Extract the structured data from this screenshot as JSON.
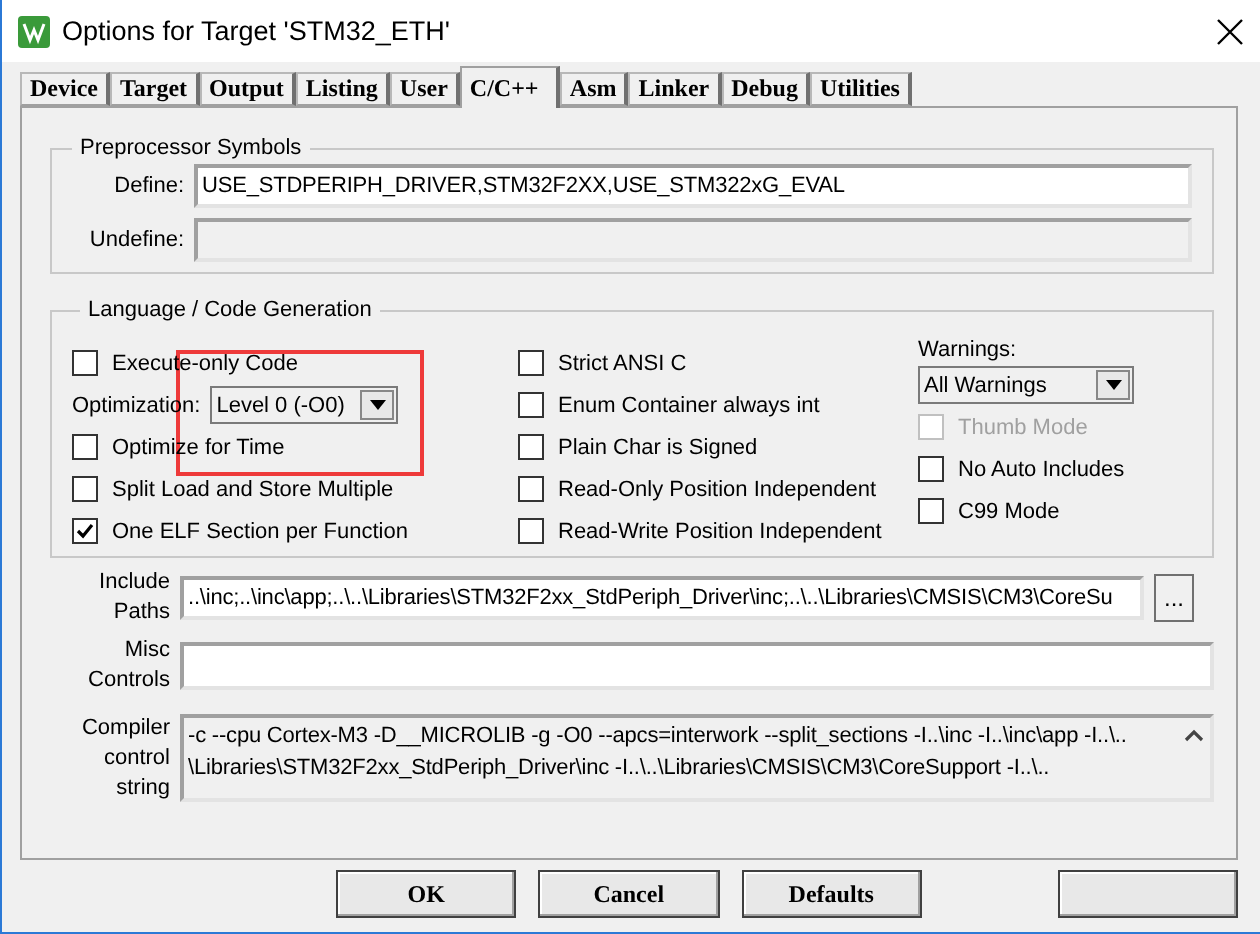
{
  "window": {
    "title": "Options for Target 'STM32_ETH'"
  },
  "tabs": [
    {
      "label": "Device",
      "selected": false
    },
    {
      "label": "Target",
      "selected": false
    },
    {
      "label": "Output",
      "selected": false
    },
    {
      "label": "Listing",
      "selected": false
    },
    {
      "label": "User",
      "selected": false
    },
    {
      "label": "C/C++",
      "selected": true
    },
    {
      "label": "Asm",
      "selected": false
    },
    {
      "label": "Linker",
      "selected": false
    },
    {
      "label": "Debug",
      "selected": false
    },
    {
      "label": "Utilities",
      "selected": false
    }
  ],
  "preprocessor": {
    "title": "Preprocessor Symbols",
    "define": {
      "label": "Define:",
      "value": "USE_STDPERIPH_DRIVER,STM32F2XX,USE_STM322xG_EVAL"
    },
    "undefine": {
      "label": "Undefine:",
      "disabled": true
    }
  },
  "language": {
    "title": "Language / Code Generation",
    "columns": [
      [
        {
          "kind": "checkbox",
          "label": "Execute-only Code",
          "checked": false,
          "disabled": false
        },
        {
          "kind": "select",
          "label": "Optimization:",
          "value": "Level 0 (-O0)"
        },
        {
          "kind": "checkbox",
          "label": "Optimize for Time",
          "checked": false,
          "disabled": false
        },
        {
          "kind": "checkbox",
          "label": "Split Load and Store Multiple",
          "checked": false,
          "disabled": false
        },
        {
          "kind": "checkbox",
          "label": "One ELF Section per Function",
          "checked": true,
          "disabled": false
        }
      ],
      [
        {
          "kind": "checkbox",
          "label": "Strict ANSI C",
          "checked": false,
          "disabled": false
        },
        {
          "kind": "checkbox",
          "label": "Enum Container always int",
          "checked": false,
          "disabled": false
        },
        {
          "kind": "checkbox",
          "label": "Plain Char is Signed",
          "checked": false,
          "disabled": false
        },
        {
          "kind": "checkbox",
          "label": "Read-Only Position Independent",
          "checked": false,
          "disabled": false
        },
        {
          "kind": "checkbox",
          "label": "Read-Write Position Independent",
          "checked": false,
          "disabled": false
        }
      ],
      [
        {
          "kind": "label",
          "label": "Warnings:"
        },
        {
          "kind": "select",
          "value": "All Warnings"
        },
        {
          "kind": "checkbox",
          "label": "Thumb Mode",
          "checked": false,
          "disabled": true
        },
        {
          "kind": "checkbox",
          "label": "No Auto Includes",
          "checked": false,
          "disabled": false
        },
        {
          "kind": "checkbox",
          "label": "C99 Mode",
          "checked": false,
          "disabled": false
        }
      ]
    ]
  },
  "fields": [
    {
      "kind": "path",
      "label": [
        "Include",
        "Paths"
      ],
      "value": "..\\inc;..\\inc\\app;..\\..\\Libraries\\STM32F2xx_StdPeriph_Driver\\inc;..\\..\\Libraries\\CMSIS\\CM3\\CoreSu",
      "button": "..."
    },
    {
      "kind": "text",
      "label": [
        "Misc",
        "Controls"
      ]
    },
    {
      "kind": "readonly",
      "label": [
        "Compiler",
        "control",
        "string"
      ],
      "lines": [
        "-c --cpu Cortex-M3 -D__MICROLIB -g -O0 --apcs=interwork --split_sections -I..\\inc -I..\\inc\\app -I..\\..",
        "\\Libraries\\STM32F2xx_StdPeriph_Driver\\inc -I..\\..\\Libraries\\CMSIS\\CM3\\CoreSupport -I..\\.."
      ]
    }
  ],
  "buttons": [
    {
      "kind": "button",
      "label": "OK"
    },
    {
      "kind": "button",
      "label": "Cancel"
    },
    {
      "kind": "button",
      "label": "Defaults"
    },
    {
      "kind": "covered"
    }
  ],
  "highlight": {
    "kind": "rectangle"
  }
}
